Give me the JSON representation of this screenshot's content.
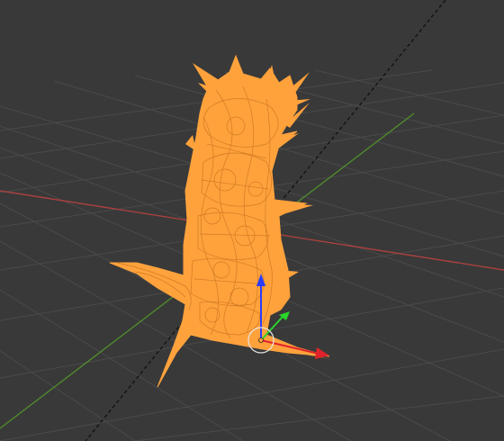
{
  "viewport": {
    "mode": "wireframe",
    "background_color": "#393939",
    "grid_color": "#4a4a4a",
    "x_axis_color": "#a8413f",
    "y_axis_color": "#4f8a2c",
    "object_color": "#ffa23c",
    "selected": true
  },
  "gizmo": {
    "type": "translate",
    "x_arrow_color": "#e0232b",
    "y_arrow_color": "#2bd52b",
    "z_arrow_color": "#2a3cff",
    "pivot_ring_color": "#e6e6e6",
    "icons": {
      "x_arrow": "arrow-x-icon",
      "y_arrow": "arrow-y-icon",
      "z_arrow": "arrow-z-icon",
      "pivot": "pivot-ring-icon"
    }
  },
  "light": {
    "guide": "dashed-line"
  }
}
